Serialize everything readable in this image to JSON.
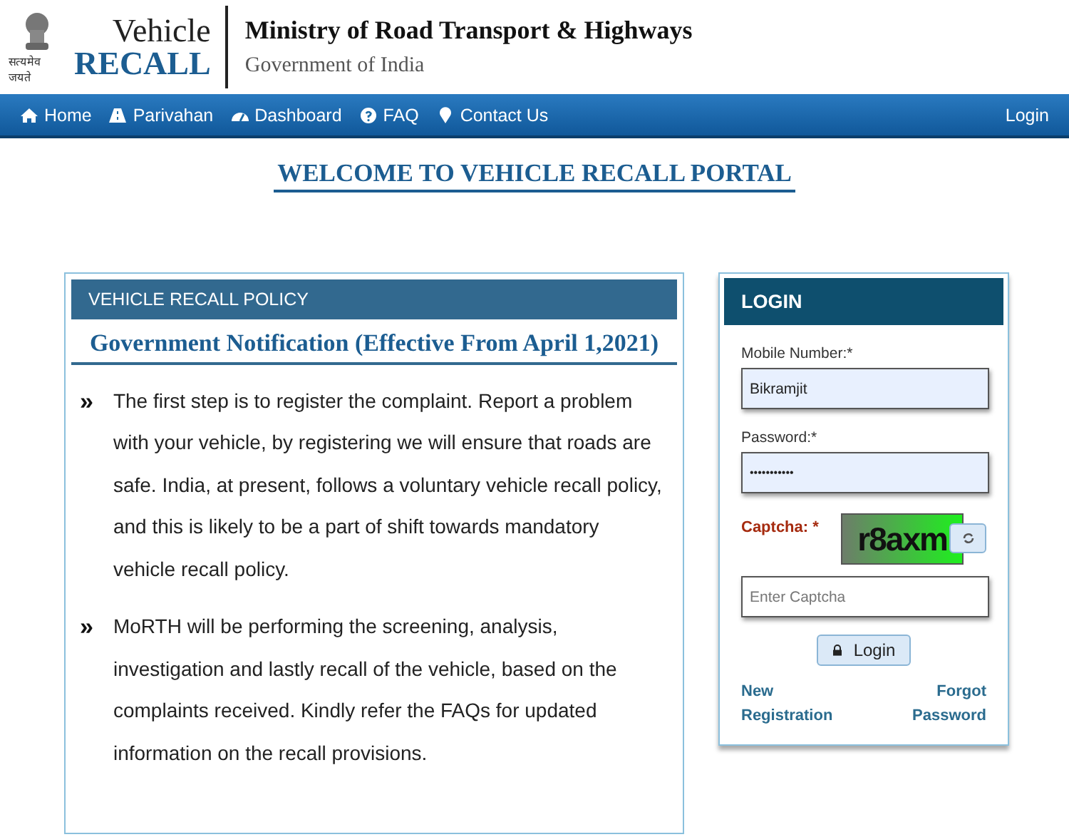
{
  "header": {
    "motto": "सत्यमेव जयते",
    "brand_line_1": "Vehicle",
    "brand_line_2": "RECALL",
    "ministry": "Ministry of Road Transport & Highways",
    "government": "Government of India"
  },
  "nav": {
    "items": [
      {
        "label": "Home",
        "kind": "home"
      },
      {
        "label": "Parivahan",
        "kind": "road"
      },
      {
        "label": "Dashboard",
        "kind": "dashboard"
      },
      {
        "label": "FAQ",
        "kind": "question"
      },
      {
        "label": "Contact Us",
        "kind": "pin"
      }
    ],
    "login": "Login"
  },
  "page_title": "WELCOME TO VEHICLE RECALL PORTAL",
  "policy": {
    "header": "VEHICLE RECALL POLICY",
    "title": "Government Notification (Effective From April 1,2021)",
    "bullet": "»",
    "points": [
      "The first step is to register the complaint. Report a problem with your vehicle, by registering we will ensure that roads are safe. India, at present, follows a voluntary vehicle recall policy, and this is likely to be a part of shift towards mandatory vehicle recall policy.",
      "MoRTH will be performing the screening, analysis, investigation and lastly recall of the vehicle, based on the complaints received. Kindly refer the FAQs for updated information on the recall provisions."
    ]
  },
  "login": {
    "title": "LOGIN",
    "mobile_label": "Mobile Number:*",
    "mobile_value": "Bikramjit",
    "password_label": "Password:*",
    "password_value": "•••••••••••",
    "captcha_label": "Captcha: *",
    "captcha_text": "r8axm",
    "captcha_placeholder": "Enter Captcha",
    "button": "Login",
    "new_registration": "New Registration",
    "forgot_password": "Forgot Password"
  }
}
